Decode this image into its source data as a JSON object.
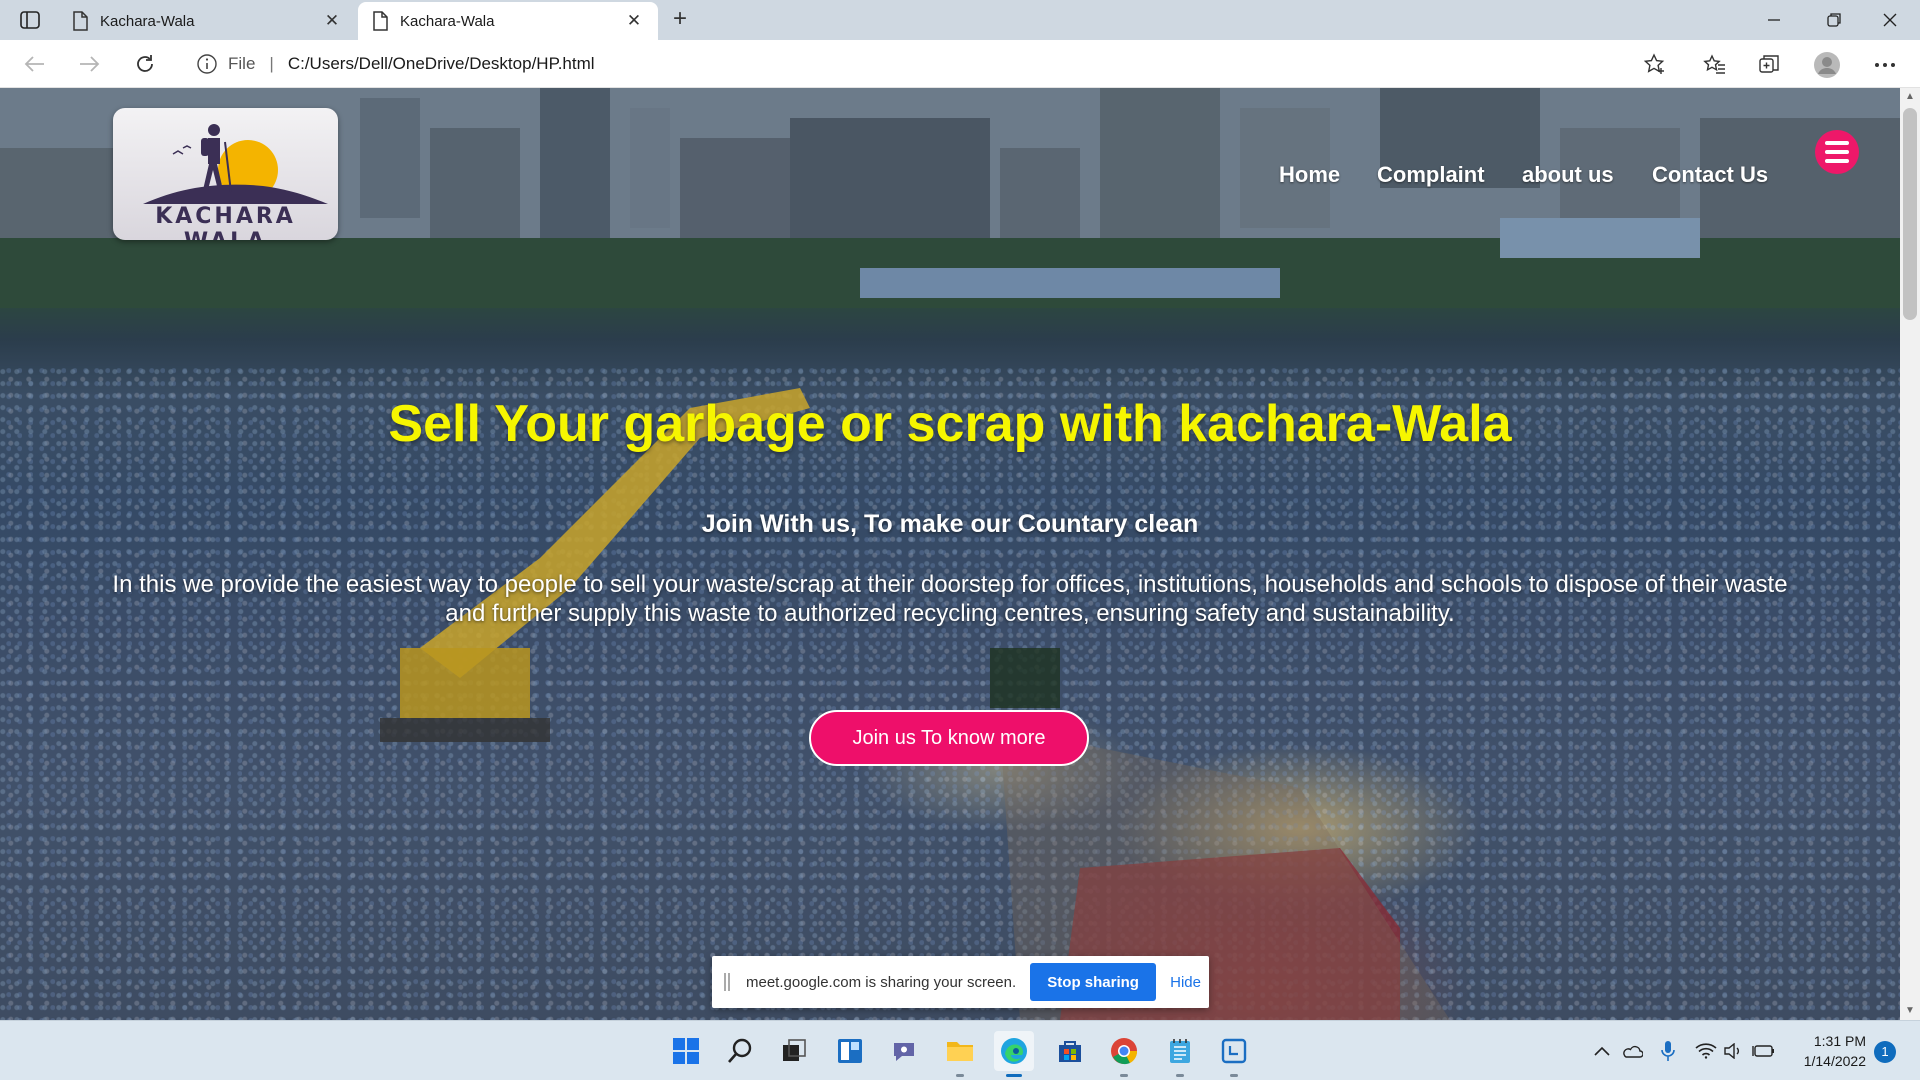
{
  "browser": {
    "tabs": [
      {
        "title": "Kachara-Wala",
        "active": false
      },
      {
        "title": "Kachara-Wala",
        "active": true
      }
    ],
    "close_glyph": "✕",
    "newtab_glyph": "+",
    "address": {
      "scheme_label": "File",
      "separator": "|",
      "url": "C:/Users/Dell/OneDrive/Desktop/HP.html"
    }
  },
  "page": {
    "logo_text": "KACHARA WALA",
    "nav": {
      "home": "Home",
      "complaint": "Complaint",
      "about": "about us",
      "contact": "Contact Us"
    },
    "hero": {
      "title": "Sell Your garbage or scrap with kachara-Wala",
      "subtitle": "Join With us, To make our Countary clean",
      "description": "In this we provide the easiest way to people to sell your waste/scrap at their doorstep for offices, institutions, households and schools to dispose of their waste and further supply this waste to authorized recycling centres, ensuring safety and sustainability.",
      "cta_label": "Join us To know more"
    },
    "colors": {
      "title_yellow": "#f6f600",
      "accent_pink": "#ee0f6a"
    }
  },
  "share_notice": {
    "message": "meet.google.com is sharing your screen.",
    "stop_label": "Stop sharing",
    "hide_label": "Hide"
  },
  "taskbar": {
    "icons": [
      "windows-start-icon",
      "search-icon",
      "task-view-icon",
      "widgets-icon",
      "teams-chat-icon",
      "file-explorer-icon",
      "edge-icon",
      "store-icon",
      "chrome-icon",
      "notepad-icon",
      "snipping-icon"
    ],
    "clock_time": "1:31 PM",
    "clock_date": "1/14/2022",
    "notification_count": "1"
  }
}
